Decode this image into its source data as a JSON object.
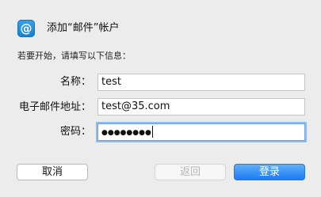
{
  "header": {
    "icon": "at-sign-mail-icon",
    "icon_glyph": "@",
    "title": "添加“邮件”帐户"
  },
  "intro_text": "若要开始，请填写以下信息：",
  "form": {
    "name": {
      "label": "名称：",
      "value": "test"
    },
    "email": {
      "label": "电子邮件地址：",
      "value": "test@35.com"
    },
    "password": {
      "label": "密码：",
      "value": "●●●●●●●●"
    }
  },
  "buttons": {
    "cancel": "取消",
    "back": "返回",
    "login": "登录"
  },
  "colors": {
    "accent": "#1c7bf2",
    "focus_ring": "#8fbcf5",
    "background": "#ececec"
  }
}
